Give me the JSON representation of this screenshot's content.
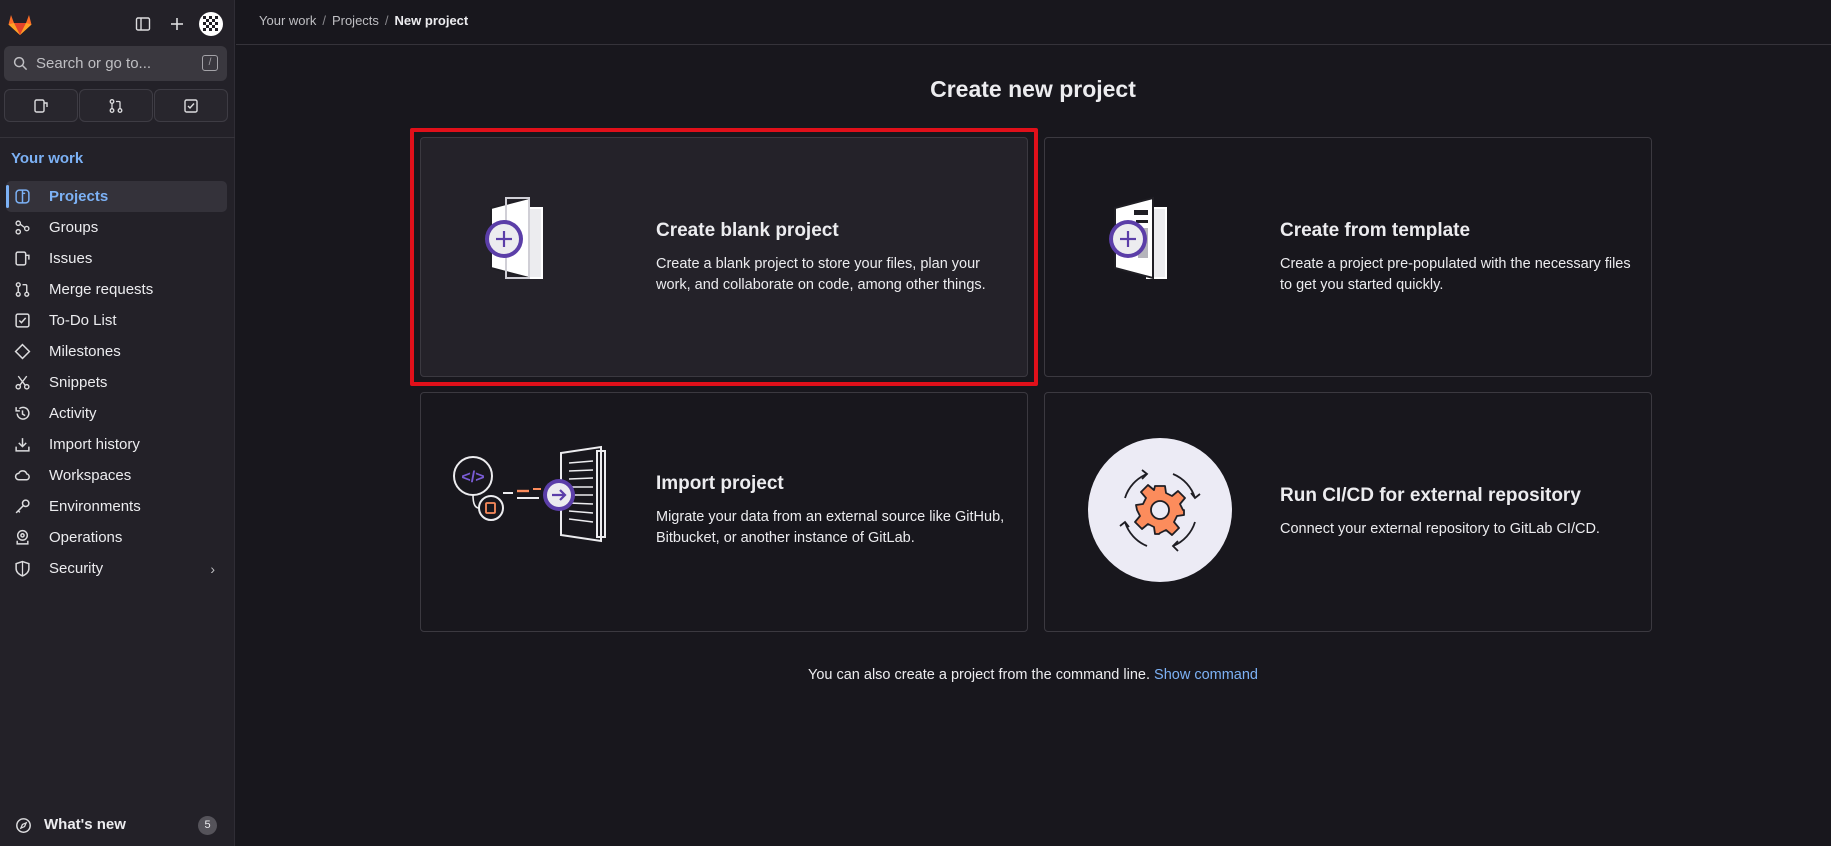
{
  "sidebar": {
    "search_placeholder": "Search or go to...",
    "search_shortcut": "/",
    "section_title": "Your work",
    "items": [
      {
        "label": "Projects",
        "icon": "project-icon"
      },
      {
        "label": "Groups",
        "icon": "group-icon"
      },
      {
        "label": "Issues",
        "icon": "issues-icon"
      },
      {
        "label": "Merge requests",
        "icon": "merge-request-icon"
      },
      {
        "label": "To-Do List",
        "icon": "todo-icon"
      },
      {
        "label": "Milestones",
        "icon": "milestone-icon"
      },
      {
        "label": "Snippets",
        "icon": "snippet-icon"
      },
      {
        "label": "Activity",
        "icon": "activity-icon"
      },
      {
        "label": "Import history",
        "icon": "import-icon"
      },
      {
        "label": "Workspaces",
        "icon": "workspace-icon"
      },
      {
        "label": "Environments",
        "icon": "environment-icon"
      },
      {
        "label": "Operations",
        "icon": "operations-icon"
      },
      {
        "label": "Security",
        "icon": "shield-icon"
      }
    ],
    "active_item": "Projects",
    "whats_new_label": "What's new",
    "whats_new_count": "5"
  },
  "breadcrumb": {
    "items": [
      "Your work",
      "Projects"
    ],
    "current": "New project"
  },
  "main": {
    "title": "Create new project",
    "cards": [
      {
        "title": "Create blank project",
        "description": "Create a blank project to store your files, plan your work, and collaborate on code, among other things."
      },
      {
        "title": "Create from template",
        "description": "Create a project pre-populated with the necessary files to get you started quickly."
      },
      {
        "title": "Import project",
        "description": "Migrate your data from an external source like GitHub, Bitbucket, or another instance of GitLab."
      },
      {
        "title": "Run CI/CD for external repository",
        "description": "Connect your external repository to GitLab CI/CD."
      }
    ],
    "footer_text": "You can also create a project from the command line.",
    "footer_link": "Show command"
  },
  "colors": {
    "accent": "#7cb1f5",
    "highlight": "#e0101a",
    "illustration_purple": "#5b3ea8",
    "illustration_orange": "#fc8c5c"
  }
}
